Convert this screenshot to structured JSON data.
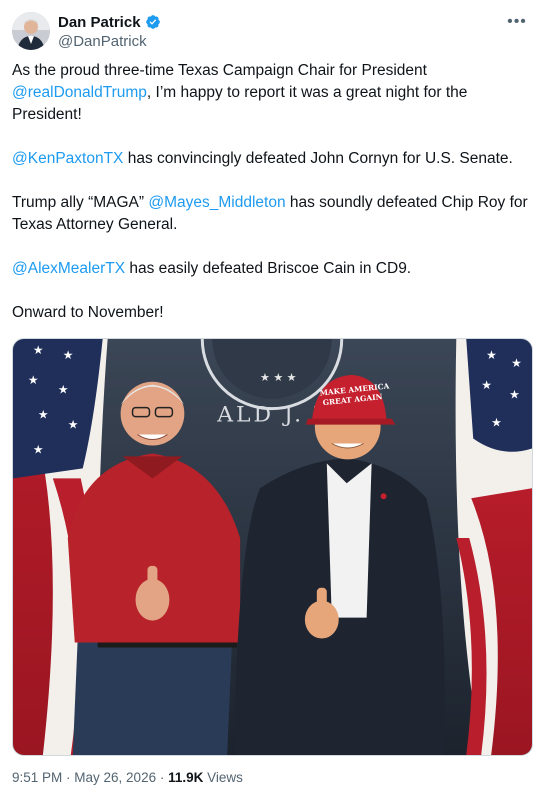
{
  "author": {
    "display_name": "Dan Patrick",
    "handle": "@DanPatrick",
    "verified": true
  },
  "icons": {
    "verified": "verified-badge-icon",
    "more": "more-options-icon"
  },
  "colors": {
    "link": "#1d9bf0",
    "verified": "#1d9bf0",
    "secondary_text": "#536471"
  },
  "tweet": {
    "p1_text1": "As the proud three-time Texas Campaign Chair for President ",
    "p1_mention": "@realDonaldTrump",
    "p1_text2": ", I’m happy to report it was a great night for the President!",
    "p2_mention": "@KenPaxtonTX",
    "p2_text": " has convincingly defeated John Cornyn for U.S. Senate.",
    "p3_text1": "Trump ally “MAGA” ",
    "p3_mention": "@Mayes_Middleton",
    "p3_text2": " has soundly defeated Chip Roy for Texas Attorney General.",
    "p4_mention": "@AlexMealerTX",
    "p4_text": " has easily defeated Briscoe Cain in CD9.",
    "p5_text": "Onward to November!"
  },
  "photo": {
    "backdrop_text": "ALD J. T    P",
    "hat_line1": "MAKE AMERICA",
    "hat_line2": "GREAT AGAIN"
  },
  "meta": {
    "time": "9:51 PM",
    "separator": " · ",
    "date": "May 26, 2026",
    "views_count": "11.9K",
    "views_label": " Views"
  }
}
